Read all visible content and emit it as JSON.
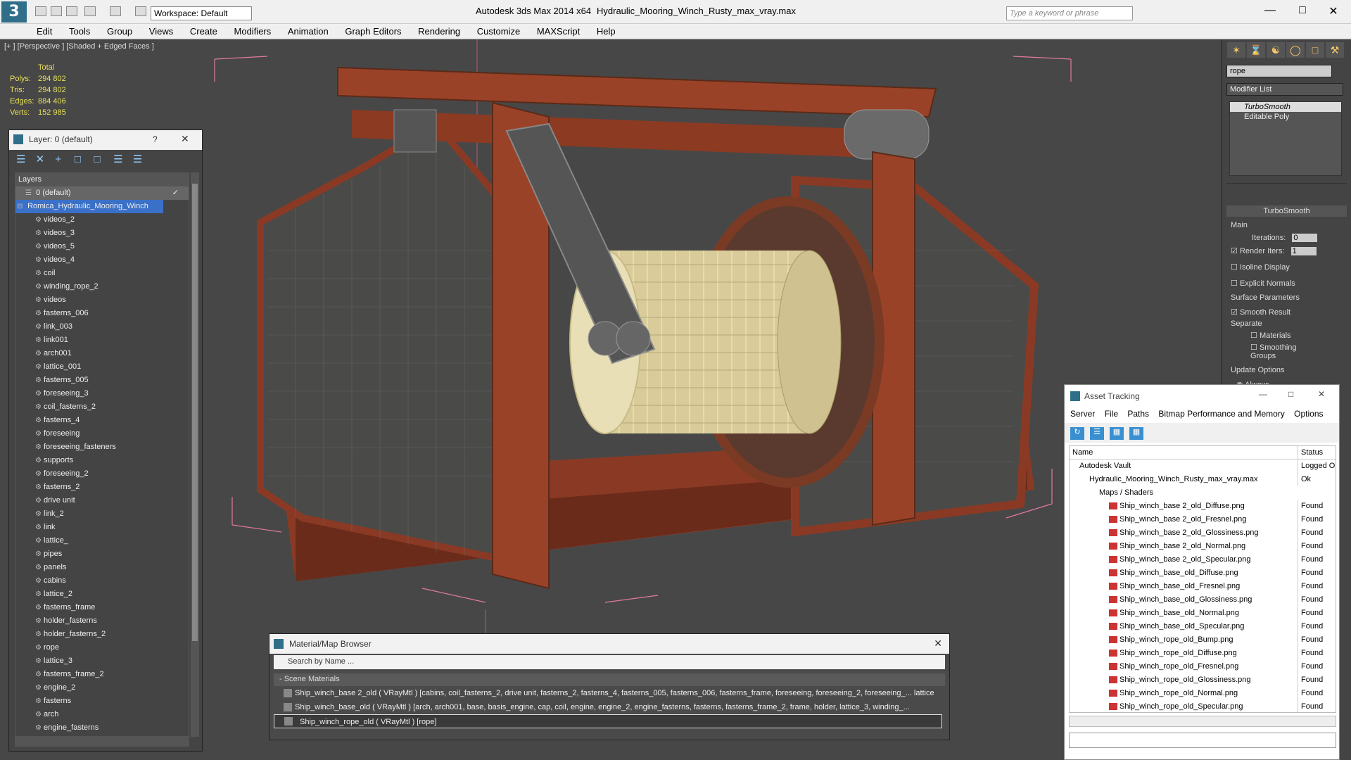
{
  "titlebar": {
    "workspace": "Workspace: Default",
    "app_title": "Autodesk 3ds Max  2014 x64",
    "file_title": "Hydraulic_Mooring_Winch_Rusty_max_vray.max",
    "search_placeholder": "Type a keyword or phrase"
  },
  "menu": [
    "Edit",
    "Tools",
    "Group",
    "Views",
    "Create",
    "Modifiers",
    "Animation",
    "Graph Editors",
    "Rendering",
    "Customize",
    "MAXScript",
    "Help"
  ],
  "viewport": {
    "label": "[+ ] [Perspective ] [Shaded + Edged Faces ]",
    "stats_header": "Total",
    "stats": [
      {
        "label": "Polys:",
        "value": "294 802"
      },
      {
        "label": "Tris:",
        "value": "294 802"
      },
      {
        "label": "Edges:",
        "value": "884 406"
      },
      {
        "label": "Verts:",
        "value": "152 985"
      }
    ]
  },
  "layer_panel": {
    "title": "Layer: 0 (default)",
    "help": "?",
    "column": "Layers",
    "layers": [
      "0 (default)",
      "Romica_Hydraulic_Mooring_Winch"
    ],
    "objects": [
      "videos_2",
      "videos_3",
      "videos_5",
      "videos_4",
      "coil",
      "winding_rope_2",
      "videos",
      "fasterns_006",
      "link_003",
      "link001",
      "arch001",
      "lattice_001",
      "fasterns_005",
      "foreseeing_3",
      "coil_fasterns_2",
      "fasterns_4",
      "foreseeing",
      "foreseeing_fasteners",
      "supports",
      "foreseeing_2",
      "fasterns_2",
      "drive unit",
      "link_2",
      "link",
      "lattice_",
      "pipes",
      "panels",
      "cabins",
      "lattice_2",
      "fasterns_frame",
      "holder_fasterns",
      "holder_fasterns_2",
      "rope",
      "lattice_3",
      "fasterns_frame_2",
      "engine_2",
      "fasterns",
      "arch",
      "engine_fasterns"
    ]
  },
  "command_panel": {
    "search": "rope",
    "modifier_list": "Modifier List",
    "stack": [
      "TurboSmooth",
      "Editable Poly"
    ],
    "rollout": "TurboSmooth",
    "main": "Main",
    "iterations_label": "Iterations:",
    "iterations": "0",
    "render_iters_label": "Render Iters:",
    "render_iters": "1",
    "isoline": "Isoline Display",
    "explicit": "Explicit Normals",
    "surface": "Surface Parameters",
    "smooth_result": "Smooth Result",
    "separate": "Separate",
    "materials": "Materials",
    "smoothing_groups": "Smoothing Groups",
    "update_options": "Update Options",
    "always": "Always"
  },
  "material_browser": {
    "title": "Material/Map Browser",
    "search_placeholder": "Search by Name ...",
    "section": "- Scene Materials",
    "items": [
      "Ship_winch_base 2_old  ( VRayMtl ) [cabins, coil_fasterns_2, drive unit, fasterns_2, fasterns_4, fasterns_005, fasterns_006, fasterns_frame, foreseeing, foreseeing_2, foreseeing_... lattice",
      "Ship_winch_base_old  ( VRayMtl ) [arch, arch001, base, basis_engine, cap, coil, engine, engine_2, engine_fasterns, fasterns, fasterns_frame_2, frame, holder, lattice_3, winding_...",
      "Ship_winch_rope_old  ( VRayMtl ) [rope]"
    ]
  },
  "asset_tracking": {
    "title": "Asset Tracking",
    "menu": [
      "Server",
      "File",
      "Paths",
      "Bitmap Performance and Memory",
      "Options"
    ],
    "col_name": "Name",
    "col_status": "Status",
    "rows": [
      {
        "name": "Autodesk Vault",
        "status": "Logged Ou",
        "indent": 1
      },
      {
        "name": "Hydraulic_Mooring_Winch_Rusty_max_vray.max",
        "status": "Ok",
        "indent": 2
      },
      {
        "name": "Maps / Shaders",
        "status": "",
        "indent": 3
      },
      {
        "name": "Ship_winch_base 2_old_Diffuse.png",
        "status": "Found",
        "indent": 4
      },
      {
        "name": "Ship_winch_base 2_old_Fresnel.png",
        "status": "Found",
        "indent": 4
      },
      {
        "name": "Ship_winch_base 2_old_Glossiness.png",
        "status": "Found",
        "indent": 4
      },
      {
        "name": "Ship_winch_base 2_old_Normal.png",
        "status": "Found",
        "indent": 4
      },
      {
        "name": "Ship_winch_base 2_old_Specular.png",
        "status": "Found",
        "indent": 4
      },
      {
        "name": "Ship_winch_base_old_Diffuse.png",
        "status": "Found",
        "indent": 4
      },
      {
        "name": "Ship_winch_base_old_Fresnel.png",
        "status": "Found",
        "indent": 4
      },
      {
        "name": "Ship_winch_base_old_Glossiness.png",
        "status": "Found",
        "indent": 4
      },
      {
        "name": "Ship_winch_base_old_Normal.png",
        "status": "Found",
        "indent": 4
      },
      {
        "name": "Ship_winch_base_old_Specular.png",
        "status": "Found",
        "indent": 4
      },
      {
        "name": "Ship_winch_rope_old_Bump.png",
        "status": "Found",
        "indent": 4
      },
      {
        "name": "Ship_winch_rope_old_Diffuse.png",
        "status": "Found",
        "indent": 4
      },
      {
        "name": "Ship_winch_rope_old_Fresnel.png",
        "status": "Found",
        "indent": 4
      },
      {
        "name": "Ship_winch_rope_old_Glossiness.png",
        "status": "Found",
        "indent": 4
      },
      {
        "name": "Ship_winch_rope_old_Normal.png",
        "status": "Found",
        "indent": 4
      },
      {
        "name": "Ship_winch_rope_old_Specular.png",
        "status": "Found",
        "indent": 4
      }
    ]
  }
}
